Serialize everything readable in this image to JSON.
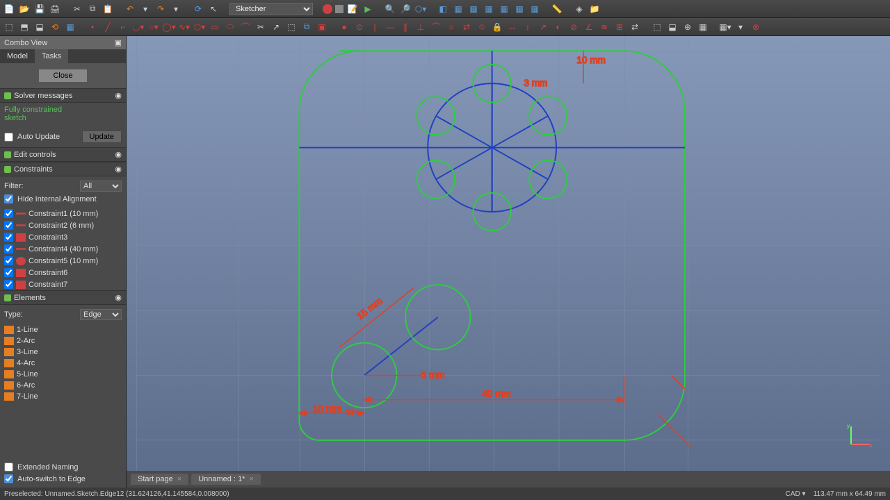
{
  "workbench": "Sketcher",
  "combo": {
    "title": "Combo View",
    "tabs": [
      "Model",
      "Tasks"
    ],
    "active_tab": 1,
    "close": "Close"
  },
  "solver": {
    "title": "Solver messages",
    "line1": "Fully constrained",
    "line2": "sketch",
    "auto_update": "Auto Update",
    "update": "Update",
    "auto_update_checked": false
  },
  "edit_controls": {
    "title": "Edit controls"
  },
  "constraints": {
    "title": "Constraints",
    "filter_label": "Filter:",
    "filter_value": "All",
    "hide_internal": "Hide Internal Alignment",
    "hide_internal_checked": true,
    "items": [
      {
        "name": "Constraint1 (10 mm)",
        "checked": true,
        "kind": "dimh"
      },
      {
        "name": "Constraint2 (6 mm)",
        "checked": true,
        "kind": "dimh"
      },
      {
        "name": "Constraint3",
        "checked": true,
        "kind": "dimg"
      },
      {
        "name": "Constraint4 (40 mm)",
        "checked": true,
        "kind": "dimh"
      },
      {
        "name": "Constraint5 (10 mm)",
        "checked": true,
        "kind": "dimr"
      },
      {
        "name": "Constraint6",
        "checked": true,
        "kind": "dimg"
      },
      {
        "name": "Constraint7",
        "checked": true,
        "kind": "dimg"
      }
    ]
  },
  "elements": {
    "title": "Elements",
    "type_label": "Type:",
    "type_value": "Edge",
    "items": [
      {
        "name": "1-Line"
      },
      {
        "name": "2-Arc"
      },
      {
        "name": "3-Line"
      },
      {
        "name": "4-Arc"
      },
      {
        "name": "5-Line"
      },
      {
        "name": "6-Arc"
      },
      {
        "name": "7-Line"
      }
    ],
    "extended_naming": "Extended Naming",
    "extended_naming_checked": false,
    "auto_switch": "Auto-switch to Edge",
    "auto_switch_checked": true
  },
  "doc_tabs": [
    {
      "label": "Start page"
    },
    {
      "label": "Unnamed : 1*"
    }
  ],
  "status": {
    "left": "Preselected: Unnamed.Sketch.Edge12 (31.624126,41.145584,0.008000)",
    "right_mode": "CAD ▾",
    "right_dim": "113.47 mm x 64.49 mm"
  },
  "sketch": {
    "dims": {
      "d5mm": "5 mm",
      "d15mm": "15 mm",
      "d40mm": "40 mm",
      "d10mm_left": "10 mm",
      "d37": "37",
      "d10mm_top": "10 mm",
      "d3mm": "3 mm"
    }
  }
}
